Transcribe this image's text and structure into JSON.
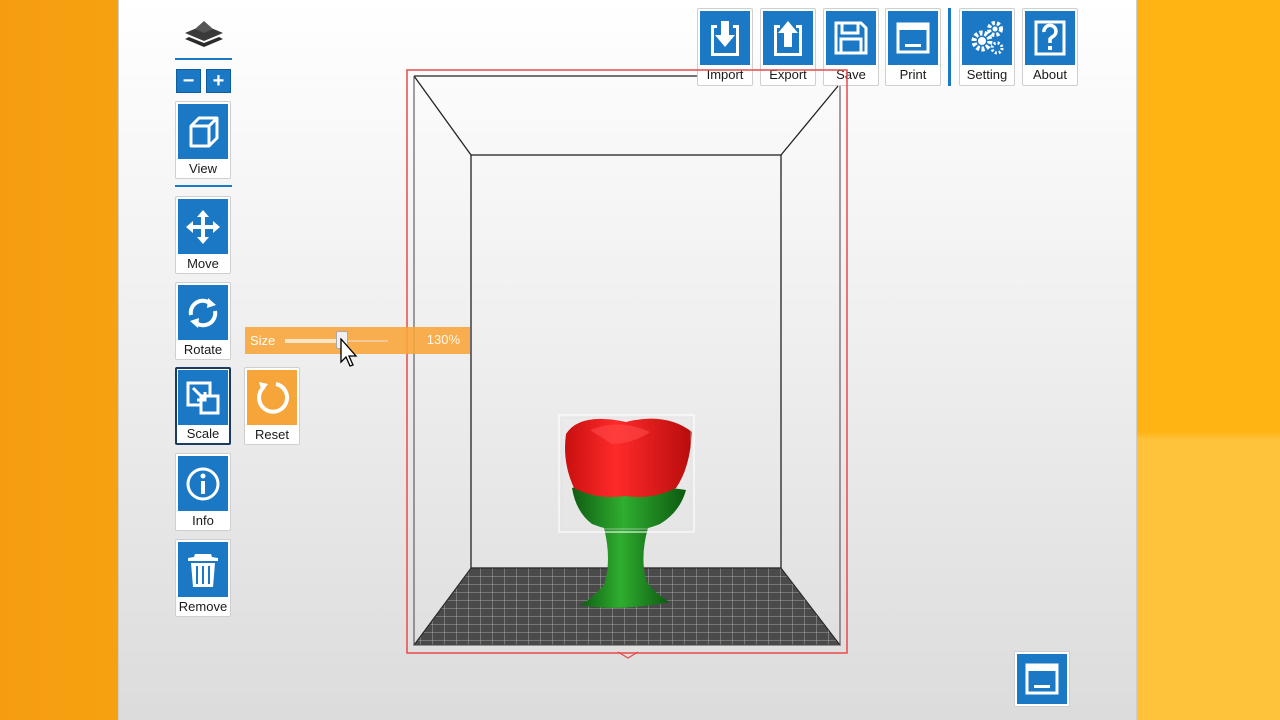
{
  "toolbar": {
    "import_label": "Import",
    "export_label": "Export",
    "save_label": "Save",
    "print_label": "Print",
    "setting_label": "Setting",
    "about_label": "About"
  },
  "sidebar": {
    "zoom_out": "−",
    "zoom_in": "+",
    "view_label": "View",
    "move_label": "Move",
    "rotate_label": "Rotate",
    "scale_label": "Scale",
    "info_label": "Info",
    "remove_label": "Remove",
    "reset_label": "Reset"
  },
  "scale_panel": {
    "size_label": "Size",
    "size_value": "130%",
    "slider_fraction": 0.55
  },
  "colors": {
    "accent_blue": "#1b78c4",
    "panel_orange": "#f6a53a",
    "build_volume_outline": "#e84a4a",
    "model_red": "#e31b1b",
    "model_green": "#1f8a1f"
  },
  "icons": {
    "import": "download-icon",
    "export": "upload-icon",
    "save": "floppy-icon",
    "print": "printer-window-icon",
    "setting": "gears-icon",
    "about": "question-icon",
    "view": "cube-icon",
    "move": "move-arrows-icon",
    "rotate": "rotate-icon",
    "scale": "scale-icon",
    "info": "info-icon",
    "remove": "trash-icon",
    "reset": "reset-icon",
    "corner": "window-icon"
  }
}
